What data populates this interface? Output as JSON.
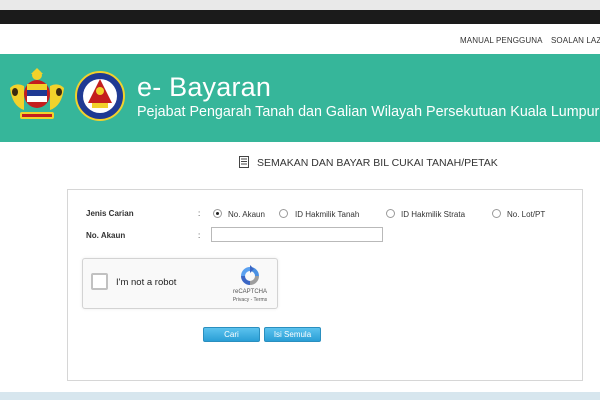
{
  "nav": {
    "links": [
      "MANUAL PENGGUNA",
      "SOALAN LAZIM"
    ]
  },
  "header": {
    "title": "e- Bayaran",
    "subtitle": "Pejabat Pengarah Tanah dan Galian Wilayah Persekutuan Kuala Lumpur"
  },
  "section": {
    "heading": "SEMAKAN DAN BAYAR BIL CUKAI TANAH/PETAK"
  },
  "form": {
    "search_type_label": "Jenis Carian",
    "colon": ":",
    "search_options": [
      "No. Akaun",
      "ID Hakmilik Tanah",
      "ID Hakmilik Strata",
      "No. Lot/PT"
    ],
    "selected_option": "No. Akaun",
    "account_label": "No. Akaun",
    "account_value": ""
  },
  "recaptcha": {
    "label": "I'm not a robot",
    "brand": "reCAPTCHA",
    "terms": "Privacy - Terms"
  },
  "buttons": {
    "search": "Cari",
    "reset": "Isi Semula"
  },
  "colors": {
    "banner": "#36b69a",
    "top_bar": "#1b1b1b",
    "button": "#2a9fd6"
  }
}
